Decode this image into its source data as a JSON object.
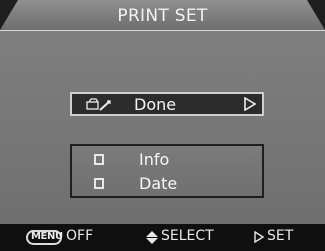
{
  "screen": {
    "title": "PRINT SET",
    "done_item": {
      "label": "Done",
      "left_icon": "printer-icon",
      "right_icon": "right-arrow-icon"
    },
    "options": [
      {
        "label": "Info",
        "checked": false,
        "icon": "checkbox-icon"
      },
      {
        "label": "Date",
        "checked": false,
        "icon": "checkbox-icon"
      }
    ],
    "footer": {
      "menu_button_label": "MENU",
      "menu_action_label": "OFF",
      "select_icon": "up-down-arrow-icon",
      "select_label": "SELECT",
      "set_icon": "right-arrow-icon",
      "set_label": "SET"
    }
  },
  "colors": {
    "panel_gray": "#7a7a7a",
    "dark_bg": "#1e1e1e",
    "text_white": "#f5f5f5"
  }
}
